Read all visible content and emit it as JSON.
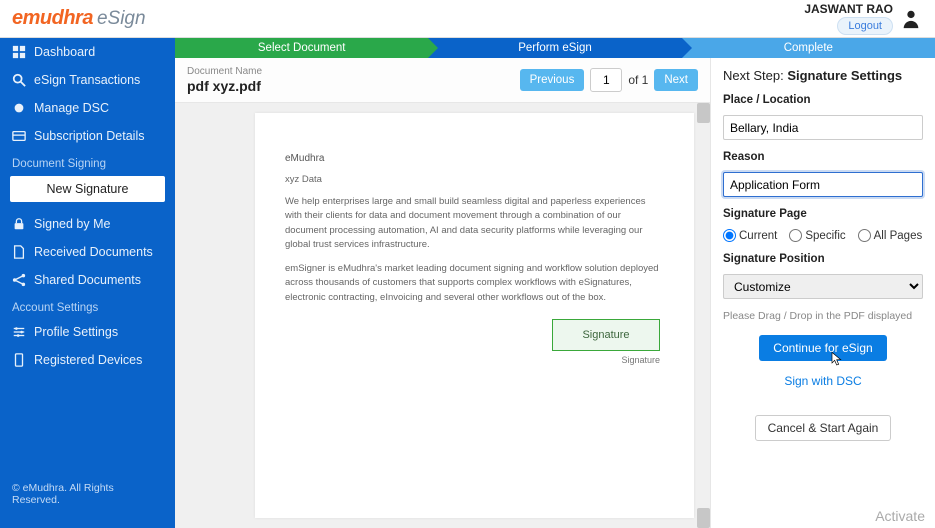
{
  "header": {
    "logo_main": "emudhra",
    "logo_sub": "eSign",
    "user_name": "JASWANT RAO",
    "logout": "Logout"
  },
  "sidebar": {
    "nav": [
      {
        "label": "Dashboard"
      },
      {
        "label": "eSign Transactions"
      },
      {
        "label": "Manage DSC"
      },
      {
        "label": "Subscription Details"
      }
    ],
    "section_signing": "Document Signing",
    "new_signature": "New Signature",
    "signing_items": [
      {
        "label": "Signed by Me"
      },
      {
        "label": "Received Documents"
      },
      {
        "label": "Shared Documents"
      }
    ],
    "section_account": "Account Settings",
    "account_items": [
      {
        "label": "Profile Settings"
      },
      {
        "label": "Registered Devices"
      }
    ],
    "copyright": "© eMudhra. All Rights Reserved."
  },
  "steps": {
    "a": "Select Document",
    "b": "Perform eSign",
    "c": "Complete"
  },
  "docbar": {
    "name_label": "Document Name",
    "name": "pdf xyz.pdf",
    "prev": "Previous",
    "page": "1",
    "of": "of 1",
    "next": "Next"
  },
  "page": {
    "brand": "eMudhra",
    "subtitle": "xyz Data",
    "para1": "We help enterprises large and small build seamless digital and paperless experiences with their clients for data and document movement through a combination of our document processing automation, AI and data security platforms while leveraging our global trust services infrastructure.",
    "para2": "emSigner is eMudhra's market leading document signing and workflow solution deployed across thousands of customers that supports complex workflows with eSignatures, electronic contracting, eInvoicing and several other workflows out of the box.",
    "sig_box": "Signature",
    "sig_caption": "Signature"
  },
  "panel": {
    "next_step_prefix": "Next Step: ",
    "next_step_bold": "Signature Settings",
    "place_label": "Place / Location",
    "place_value": "Bellary, India",
    "reason_label": "Reason",
    "reason_value": "Application Form",
    "sig_page_label": "Signature Page",
    "radio_current": "Current",
    "radio_specific": "Specific",
    "radio_all": "All Pages",
    "sig_pos_label": "Signature Position",
    "sig_pos_value": "Customize",
    "hint": "Please Drag / Drop in the PDF displayed",
    "continue": "Continue for eSign",
    "sign_dsc": "Sign with DSC",
    "cancel": "Cancel & Start Again"
  },
  "watermark": "Activate"
}
